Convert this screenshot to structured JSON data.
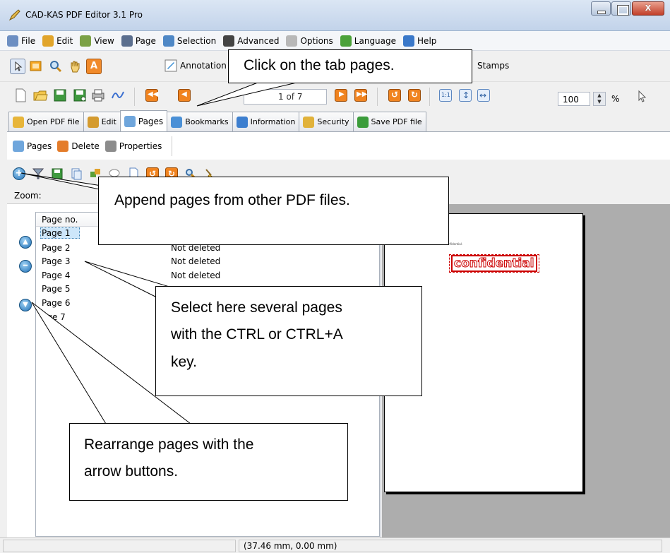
{
  "window": {
    "title": "CAD-KAS PDF Editor 3.1 Pro"
  },
  "menu": [
    {
      "label": "File",
      "icon": "document-icon",
      "color": "#6d8fc2"
    },
    {
      "label": "Edit",
      "icon": "pencil-icon",
      "color": "#e1a52c"
    },
    {
      "label": "View",
      "icon": "view-icon",
      "color": "#7ba146"
    },
    {
      "label": "Page",
      "icon": "book-icon",
      "color": "#5b6f8f"
    },
    {
      "label": "Selection",
      "icon": "lasso-icon",
      "color": "#4f88c6"
    },
    {
      "label": "Advanced",
      "icon": "graduation-icon",
      "color": "#444444"
    },
    {
      "label": "Options",
      "icon": "wrench-icon",
      "color": "#b8b8b8"
    },
    {
      "label": "Language",
      "icon": "globe-icon",
      "color": "#4ca23a"
    },
    {
      "label": "Help",
      "icon": "help-icon",
      "color": "#3a78c9"
    }
  ],
  "toolbar1": {
    "annotation_label": "Annotation",
    "stamps_label": "Stamps"
  },
  "toolbar2": {
    "page_indicator": "1 of 7",
    "zoom_value": "100",
    "zoom_unit": "%"
  },
  "tabs": [
    {
      "label": "Open PDF file",
      "color": "#e7b53a"
    },
    {
      "label": "Edit",
      "color": "#d49b2f"
    },
    {
      "label": "Pages",
      "color": "#6fa6dc"
    },
    {
      "label": "Bookmarks",
      "color": "#4a90d6"
    },
    {
      "label": "Information",
      "color": "#3d7fcf"
    },
    {
      "label": "Security",
      "color": "#e1b23a"
    },
    {
      "label": "Save PDF file",
      "color": "#3b9c3b"
    }
  ],
  "subbar": [
    {
      "label": "Pages",
      "color": "#6fa6dc"
    },
    {
      "label": "Delete",
      "color": "#e47c2a"
    },
    {
      "label": "Properties",
      "color": "#8c8c8c"
    }
  ],
  "zoom_label": "Zoom:",
  "pages_list": {
    "headers": [
      "Page no.",
      ""
    ],
    "rows": [
      {
        "page": "Page 1",
        "status": ""
      },
      {
        "page": "Page 2",
        "status": "Not deleted"
      },
      {
        "page": "Page 3",
        "status": "Not deleted"
      },
      {
        "page": "Page 4",
        "status": "Not deleted"
      },
      {
        "page": "Page 5",
        "status": ""
      },
      {
        "page": "Page 6",
        "status": ""
      },
      {
        "page": "age 7",
        "status": ""
      }
    ]
  },
  "preview": {
    "tiny_text": "This document is confidential.",
    "stamp": "confidential"
  },
  "status": {
    "coords": "(37.46 mm, 0.00 mm)"
  },
  "callouts": {
    "tab_pages": "Click on the tab pages.",
    "append": "Append pages from other PDF files.",
    "select": [
      "Select here several pages",
      "with the CTRL or CTRL+A",
      "key."
    ],
    "rearrange": [
      "Rearrange pages with the",
      "arrow buttons."
    ]
  }
}
